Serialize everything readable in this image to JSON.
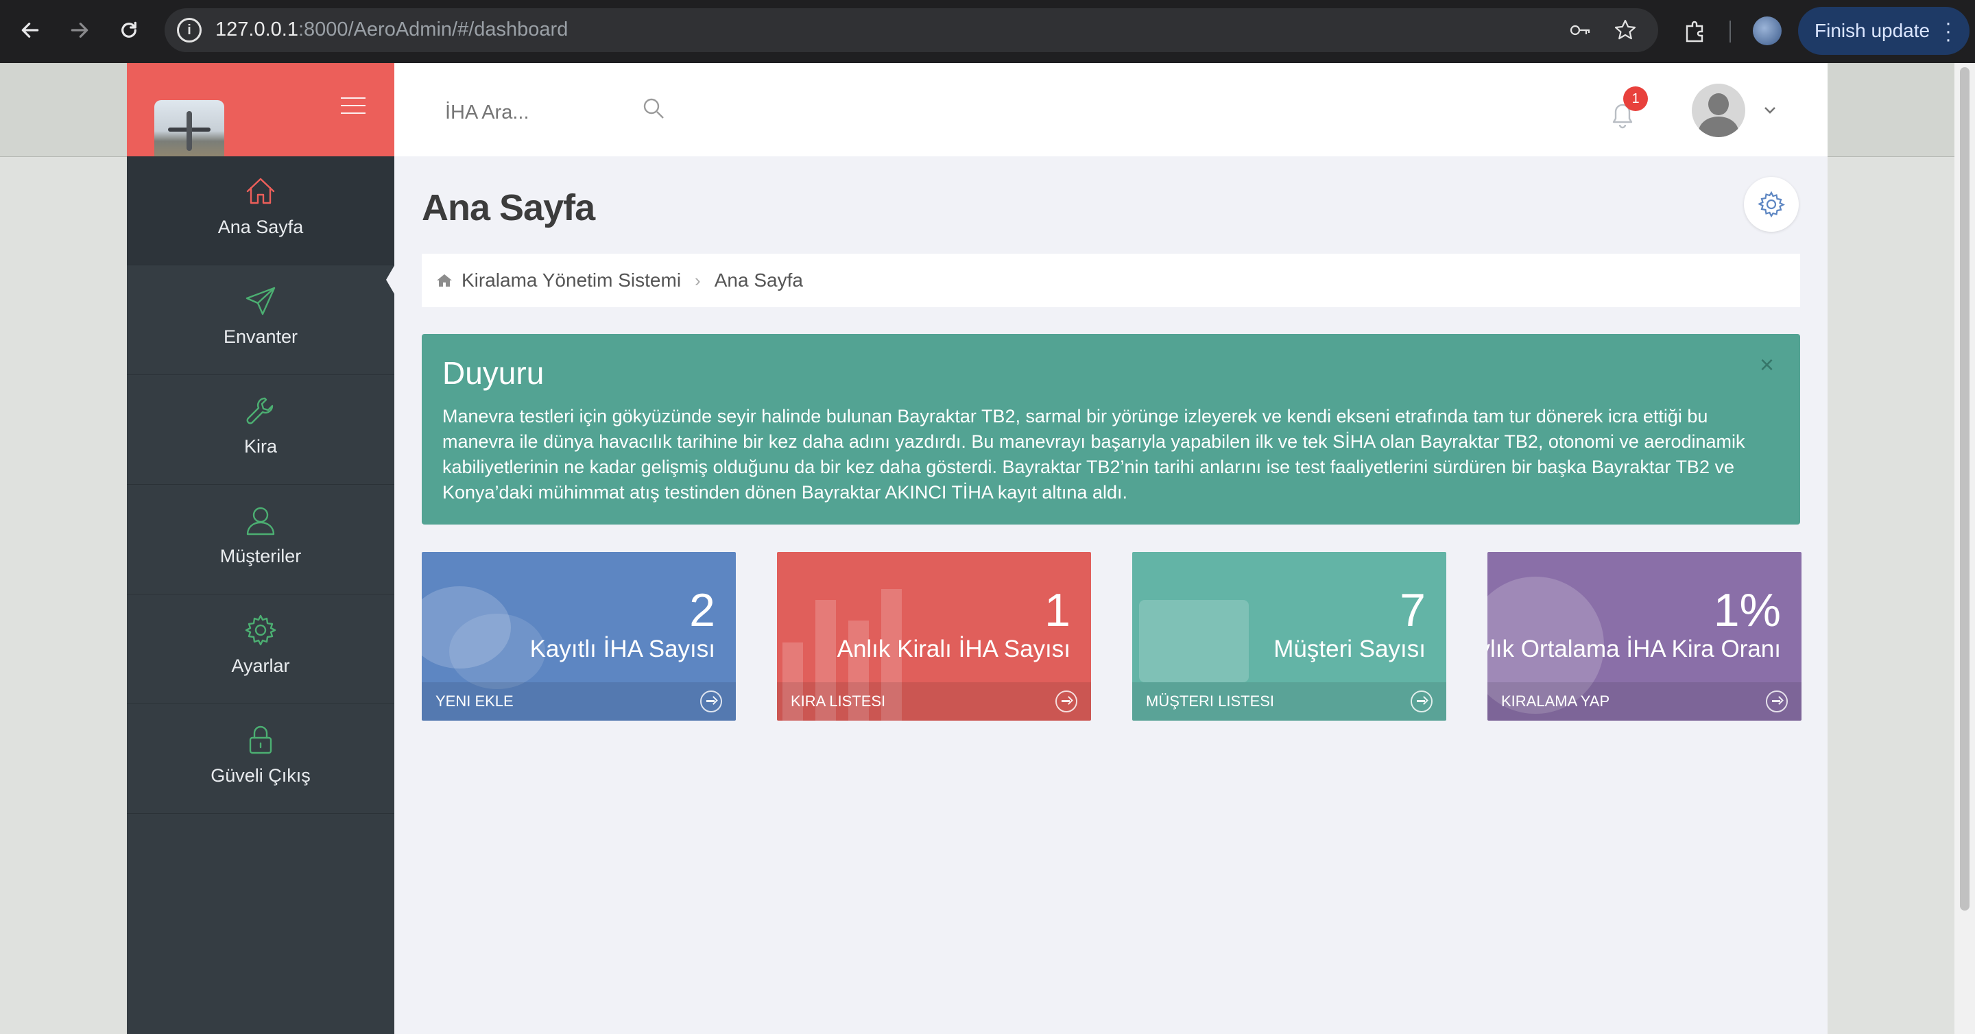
{
  "browser": {
    "url_host": "127.0.0.1",
    "url_rest": ":8000/AeroAdmin/#/dashboard",
    "update_label": "Finish update"
  },
  "sidebar": {
    "items": [
      {
        "label": "Ana Sayfa",
        "icon": "home-icon",
        "color": "#ec5f5a"
      },
      {
        "label": "Envanter",
        "icon": "paper-plane-icon",
        "color": "#4caf72"
      },
      {
        "label": "Kira",
        "icon": "wrench-icon",
        "color": "#4caf72"
      },
      {
        "label": "Müşteriler",
        "icon": "user-icon",
        "color": "#4caf72"
      },
      {
        "label": "Ayarlar",
        "icon": "gear-icon",
        "color": "#4caf72"
      },
      {
        "label": "Güveli Çıkış",
        "icon": "lock-icon",
        "color": "#4caf72"
      }
    ]
  },
  "topbar": {
    "search_placeholder": "İHA Ara...",
    "notification_count": "1"
  },
  "page": {
    "title": "Ana Sayfa",
    "breadcrumb": [
      "Kiralama Yönetim Sistemi",
      "Ana Sayfa"
    ]
  },
  "announcement": {
    "title": "Duyuru",
    "close": "×",
    "body": "Manevra testleri için gökyüzünde seyir halinde bulunan Bayraktar TB2, sarmal bir yörünge izleyerek ve kendi ekseni etrafında tam tur dönerek icra ettiği bu manevra ile dünya havacılık tarihine bir kez daha adını yazdırdı. Bu manevrayı başarıyla yapabilen ilk ve tek SİHA olan Bayraktar TB2, otonomi ve aerodinamik kabiliyetlerinin ne kadar gelişmiş olduğunu da bir kez daha gösterdi. Bayraktar TB2’nin tarihi anlarını ise test faaliyetlerini sürdüren bir başka Bayraktar TB2 ve Konya’daki mühimmat atış testinden dönen Bayraktar AKINCI TİHA kayıt altına aldı."
  },
  "stats": [
    {
      "value": "2",
      "label": "Kayıtlı İHA Sayısı",
      "action": "YENI EKLE",
      "color": "#5d86c2"
    },
    {
      "value": "1",
      "label": "Anlık Kiralı İHA Sayısı",
      "action": "KIRA LISTESI",
      "color": "#e05f5b"
    },
    {
      "value": "7",
      "label": "Müşteri Sayısı",
      "action": "MÜŞTERI LISTESI",
      "color": "#63b4a6"
    },
    {
      "value": "1%",
      "label": "Aylık Ortalama İHA Kira Oranı",
      "action": "KIRALAMA YAP",
      "color": "#8a6fa8"
    }
  ]
}
